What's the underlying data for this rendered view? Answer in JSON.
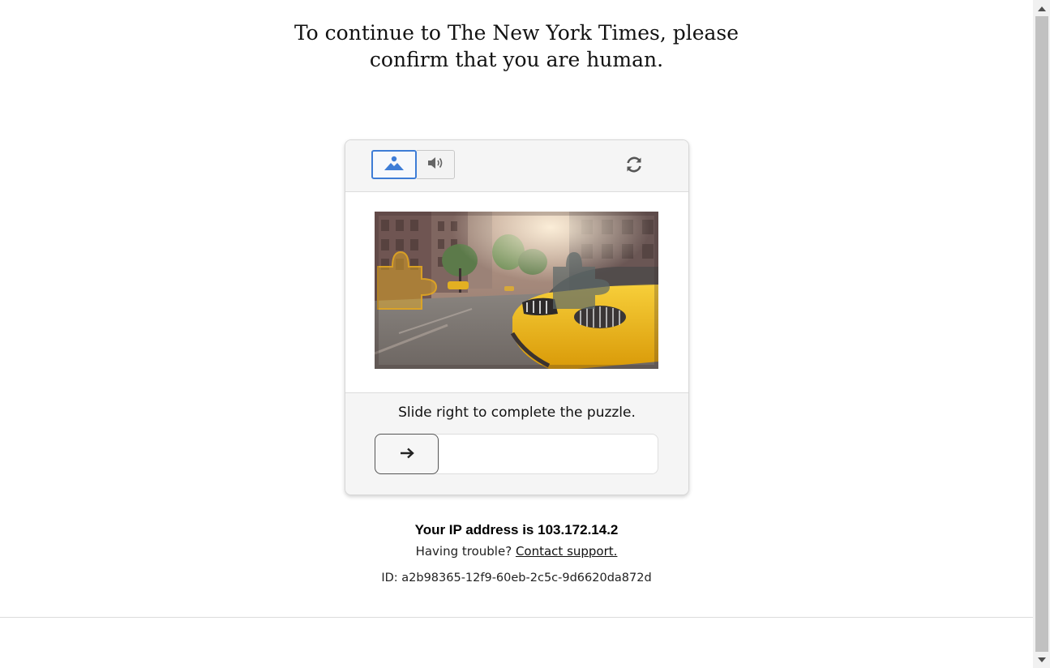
{
  "page": {
    "heading": "To continue to The New York Times, please confirm that you are human."
  },
  "captcha": {
    "modes": {
      "image_icon": "image-mode-icon",
      "audio_icon": "audio-mode-icon",
      "selected": "image"
    },
    "refresh_icon": "refresh-icon",
    "image_alt": "Street with yellow taxi puzzle image",
    "instruction": "Slide right to complete the puzzle.",
    "slider": {
      "handle_icon": "arrow-right-icon",
      "progress": 0
    }
  },
  "info": {
    "ip_text": "Your IP address is 103.172.14.2",
    "trouble_text": "Having trouble?",
    "support_link": "Contact support.",
    "id_text": "ID: a2b98365-12f9-60eb-2c5c-9d6620da872d"
  },
  "colors": {
    "accent": "#3e7dd6",
    "panel_bg": "#f5f5f5",
    "taxi_yellow": "#f2b90f"
  }
}
